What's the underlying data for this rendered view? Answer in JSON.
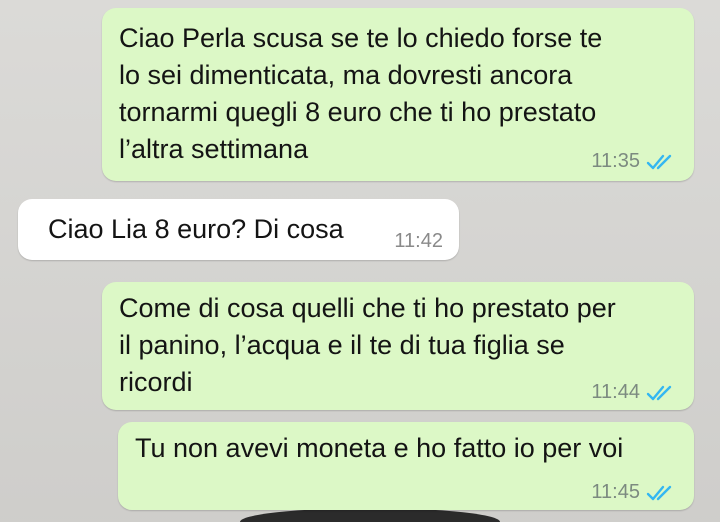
{
  "chat": {
    "messages": [
      {
        "direction": "outgoing",
        "text": "Ciao Perla scusa se te lo chiedo forse te\nlo sei dimenticata, ma dovresti ancora\ntornarmi quegli 8 euro che ti ho prestato\nl’altra settimana",
        "time": "11:35",
        "status_icon": "double-check-read-icon"
      },
      {
        "direction": "incoming",
        "text": "Ciao Lia 8 euro? Di cosa",
        "time": "11:42"
      },
      {
        "direction": "outgoing",
        "text": "Come di cosa quelli che ti ho prestato per\nil panino, l’acqua e il te di tua figlia se\nricordi",
        "time": "11:44",
        "status_icon": "double-check-read-icon"
      },
      {
        "direction": "outgoing",
        "text": "Tu non avevi moneta e ho fatto io per voi",
        "time": "11:45",
        "status_icon": "double-check-read-icon"
      }
    ]
  },
  "colors": {
    "outgoing_bubble": "#dcf8c6",
    "incoming_bubble": "#ffffff",
    "read_tick": "#34b7f1",
    "chat_background": "#d7d6d3"
  }
}
